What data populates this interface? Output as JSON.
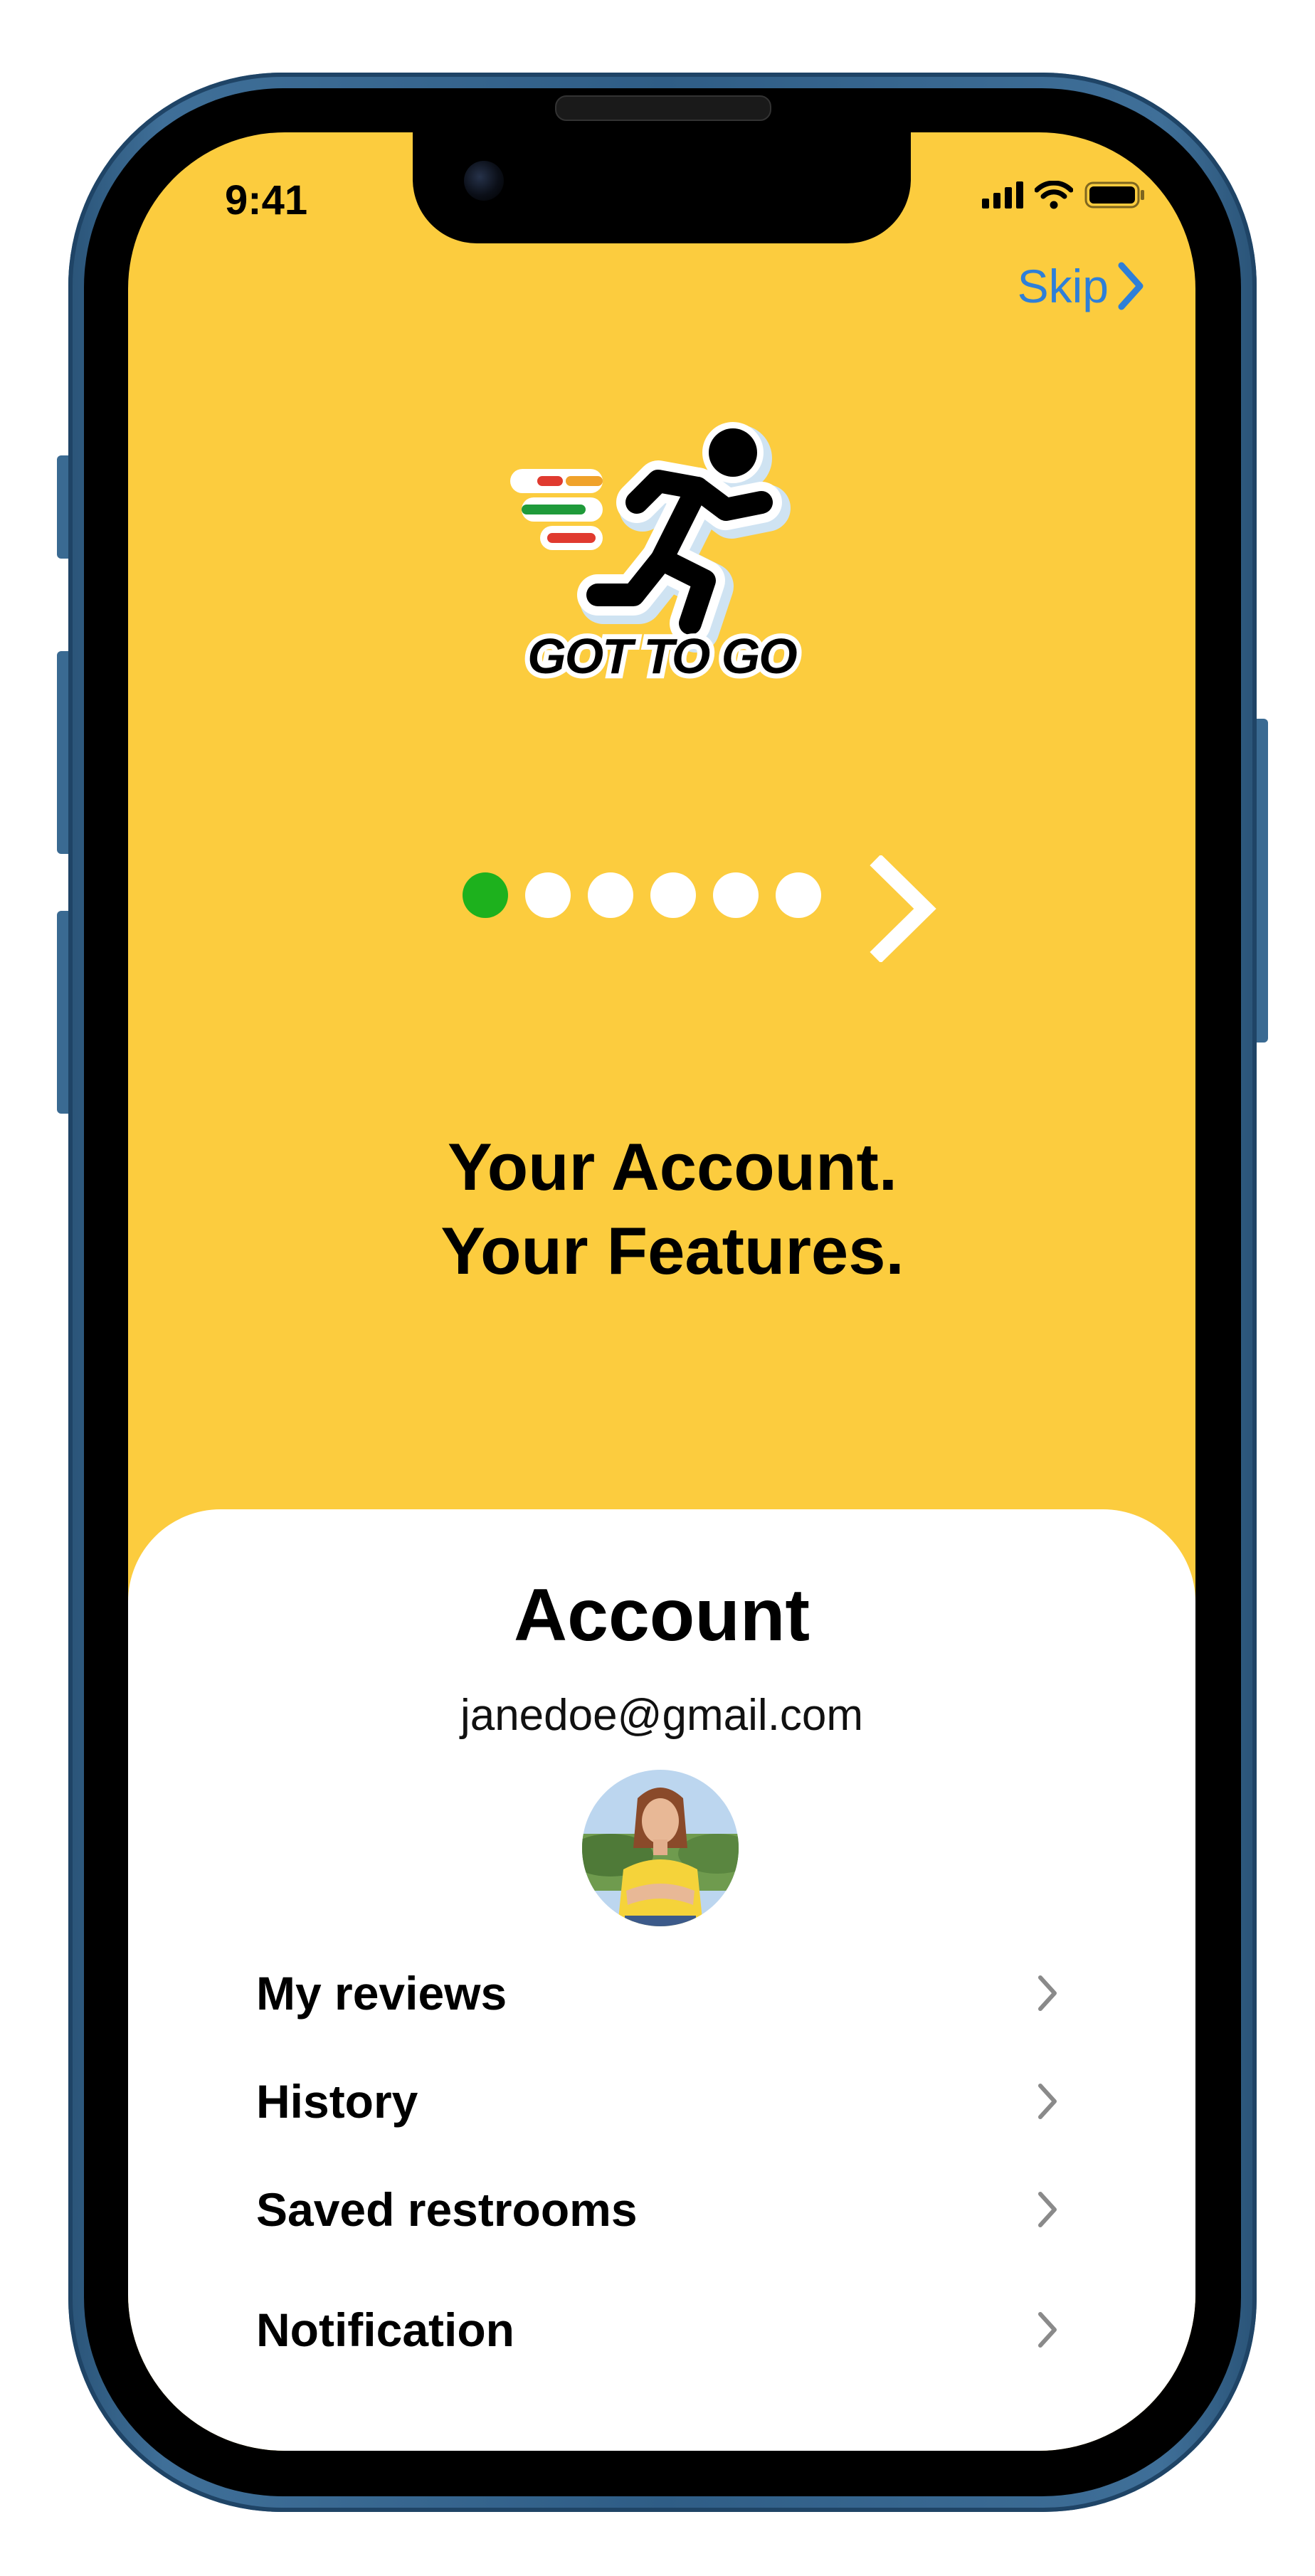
{
  "status_bar": {
    "time": "9:41"
  },
  "header": {
    "skip_label": "Skip"
  },
  "logo": {
    "text": "GOT TO GO"
  },
  "pager": {
    "total": 6,
    "active_index": 0,
    "active_color": "#1db11d"
  },
  "headline": {
    "line1": "Your Account.",
    "line2": "Your Features."
  },
  "account": {
    "title": "Account",
    "email": "janedoe@gmail.com",
    "menu": [
      {
        "label": "My reviews"
      },
      {
        "label": "History"
      },
      {
        "label": "Saved restrooms"
      },
      {
        "label": "Notification"
      }
    ]
  },
  "colors": {
    "background": "#fccc3e",
    "card": "#ffffff",
    "accent_blue": "#2e7fd8",
    "chevron_gray": "#8a8a8a"
  },
  "icons": [
    "signal-icon",
    "wifi-icon",
    "battery-icon",
    "chevron-right-icon",
    "next-arrow-icon",
    "running-man-logo"
  ]
}
